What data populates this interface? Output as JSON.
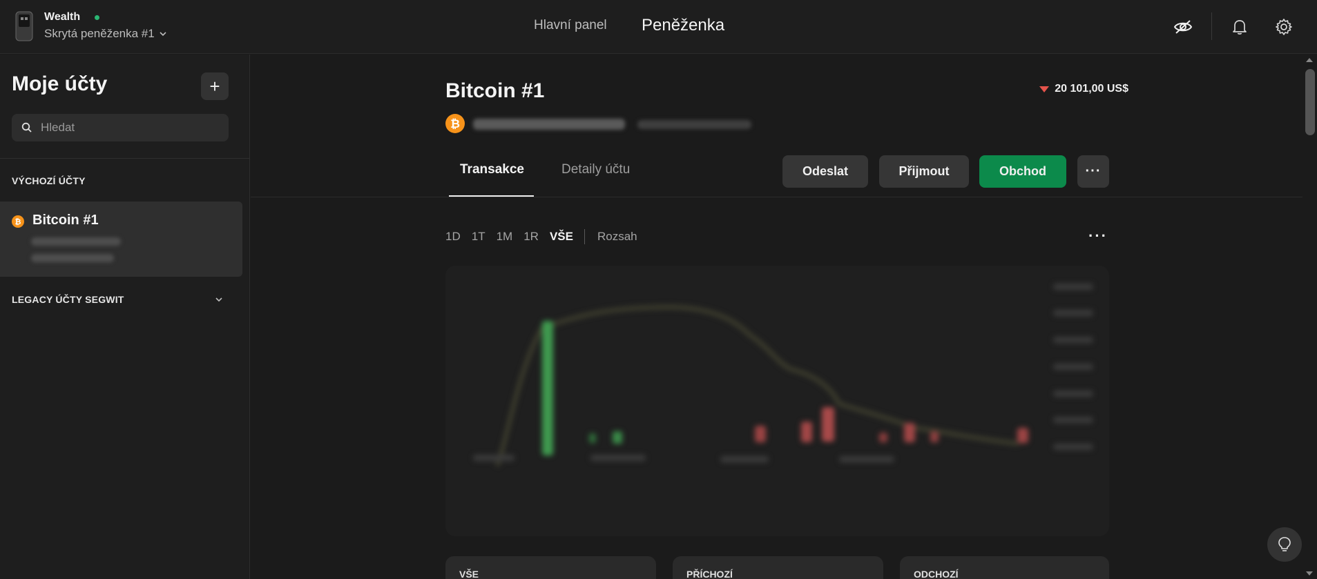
{
  "header": {
    "wallet_name": "Wealth",
    "wallet_subtitle": "Skrytá peněženka #1",
    "nav_dashboard": "Hlavní panel",
    "nav_wallet": "Peněženka",
    "icons": [
      "eye-off-icon",
      "bell-icon",
      "gear-icon"
    ]
  },
  "sidebar": {
    "title": "Moje účty",
    "add_label": "+",
    "search_placeholder": "Hledat",
    "group_default": "VÝCHOZÍ ÚČTY",
    "group_legacy": "LEGACY ÚČTY SEGWIT",
    "accounts": [
      {
        "name": "Bitcoin #1"
      }
    ]
  },
  "main": {
    "account_title": "Bitcoin #1",
    "balance_fiat": "20 101,00 US$",
    "tabs": [
      {
        "label": "Transakce"
      },
      {
        "label": "Detaily účtu"
      }
    ],
    "actions": {
      "send": "Odeslat",
      "receive": "Přijmout",
      "trade": "Obchod",
      "more": "···"
    },
    "ranges": [
      "1D",
      "1T",
      "1M",
      "1R",
      "VŠE"
    ],
    "range_custom": "Rozsah",
    "active_range": "VŠE",
    "stats": [
      "VŠE",
      "PŘÍCHOZÍ",
      "ODCHOZÍ"
    ]
  },
  "colors": {
    "accent_green": "#0c8a4b",
    "down_red": "#e5534b",
    "bitcoin_orange": "#f7931a",
    "status_green": "#2bb673"
  }
}
